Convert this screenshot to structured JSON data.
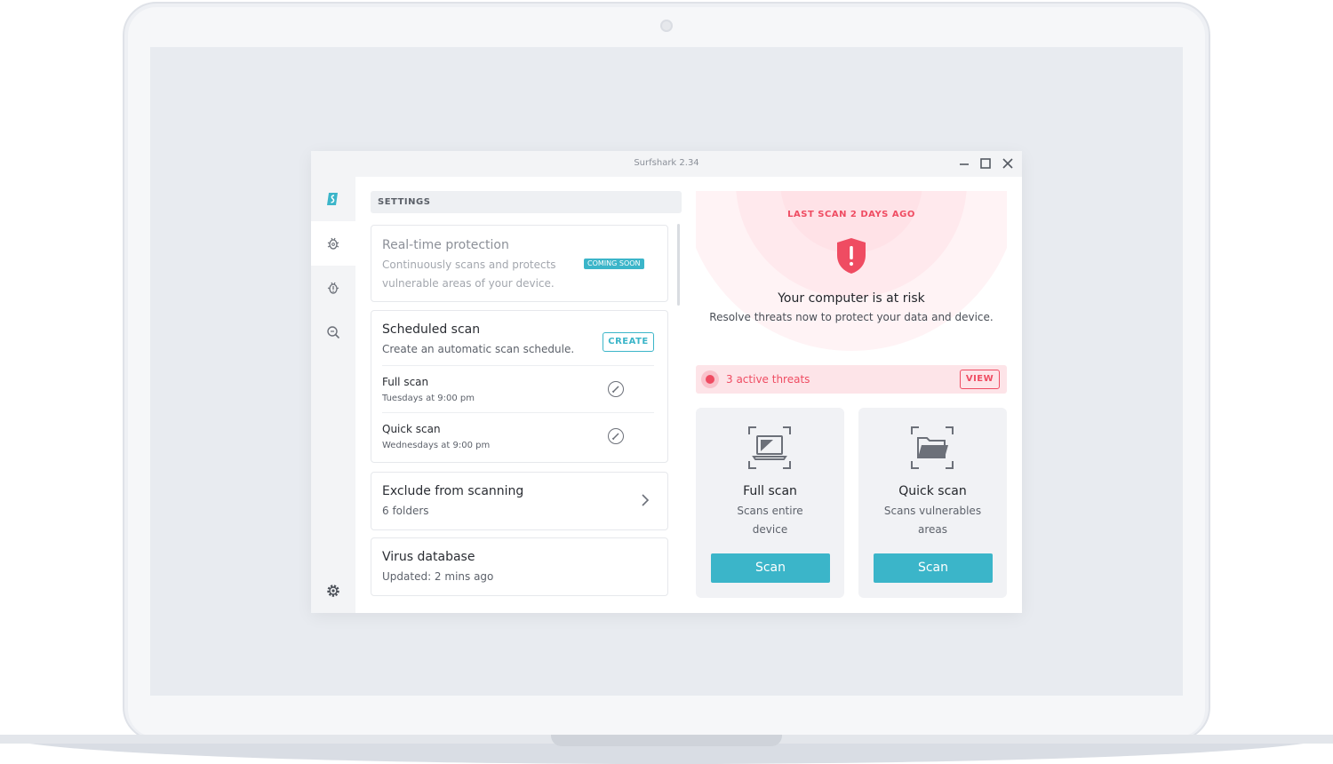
{
  "window": {
    "title": "Surfshark 2.34",
    "controls": [
      "minimize",
      "maximize",
      "close"
    ]
  },
  "sidebar": {
    "items": [
      {
        "name": "surfshark-logo-icon",
        "active": false
      },
      {
        "name": "antivirus-icon",
        "active": true
      },
      {
        "name": "alert-icon",
        "active": false
      },
      {
        "name": "search-icon",
        "active": false
      }
    ],
    "bottom": "settings-gear-icon"
  },
  "settings": {
    "header": "SETTINGS",
    "realtime": {
      "title": "Real-time protection",
      "desc_line1": "Continuously scans and protects",
      "desc_line2": "vulnerable areas of your device.",
      "badge": "COMING SOON"
    },
    "scheduled": {
      "title": "Scheduled scan",
      "desc": "Create an automatic scan schedule.",
      "create_label": "CREATE",
      "rows": [
        {
          "name": "Full scan",
          "time": "Tuesdays at 9:00 pm"
        },
        {
          "name": "Quick scan",
          "time": "Wednesdays at 9:00 pm"
        }
      ]
    },
    "exclude": {
      "title": "Exclude from scanning",
      "desc": "6 folders"
    },
    "virus_db": {
      "title": "Virus database",
      "desc": "Updated: 2 mins ago"
    }
  },
  "status": {
    "last_scan": "LAST SCAN 2 DAYS AGO",
    "title": "Your computer is at risk",
    "subtitle": "Resolve threats now to protect your data and device.",
    "threats_text": "3 active threats",
    "view_label": "VIEW"
  },
  "scans": [
    {
      "title": "Full scan",
      "desc_line1": "Scans entire",
      "desc_line2": "device",
      "button": "Scan",
      "icon": "laptop-icon"
    },
    {
      "title": "Quick scan",
      "desc_line1": "Scans vulnerables",
      "desc_line2": "areas",
      "button": "Scan",
      "icon": "folder-icon"
    }
  ],
  "colors": {
    "accent": "#3bb5c9",
    "danger": "#ef4c62",
    "danger_bg": "#fde4e8"
  }
}
